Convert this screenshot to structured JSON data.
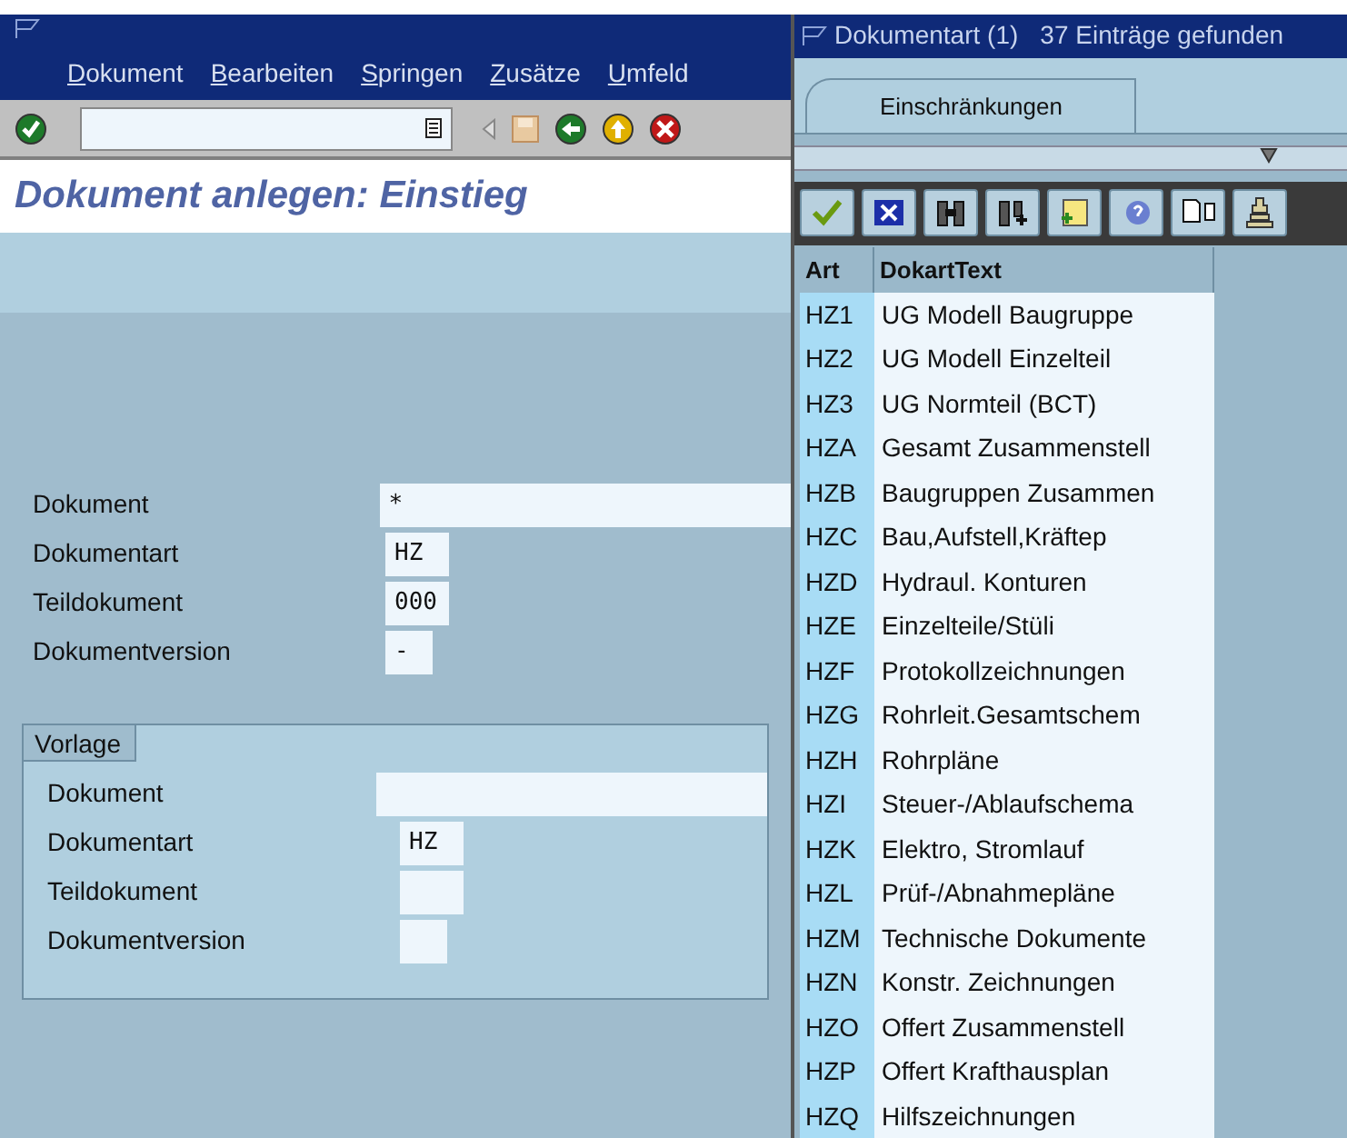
{
  "main": {
    "menu": [
      "Dokument",
      "Bearbeiten",
      "Springen",
      "Zusätze",
      "Umfeld"
    ],
    "title": "Dokument anlegen: Einstieg",
    "fields": [
      {
        "label": "Dokument",
        "value": "*"
      },
      {
        "label": "Dokumentart",
        "value": "HZ"
      },
      {
        "label": "Teildokument",
        "value": "000"
      },
      {
        "label": "Dokumentversion",
        "value": "-"
      }
    ],
    "group": {
      "title": "Vorlage",
      "fields": [
        {
          "label": "Dokument"
        },
        {
          "label": "Dokumentart",
          "value": "HZ"
        },
        {
          "label": "Teildokument"
        },
        {
          "label": "Dokumentversion"
        }
      ]
    }
  },
  "popup": {
    "title": "Dokumentart (1)",
    "count": "37 Einträge gefunden",
    "tabs": [
      {
        "label": "Einschränkungen",
        "selected": true
      }
    ],
    "columns": [
      "Art",
      "DokartText"
    ],
    "rows": [
      {
        "art": "HZ1",
        "text": "UG Modell Baugruppe"
      },
      {
        "art": "HZ2",
        "text": "UG Modell Einzelteil"
      },
      {
        "art": "HZ3",
        "text": "UG Normteil (BCT)"
      },
      {
        "art": "HZA",
        "text": "Gesamt Zusammenstell"
      },
      {
        "art": "HZB",
        "text": "Baugruppen Zusammen"
      },
      {
        "art": "HZC",
        "text": "Bau,Aufstell,Kräftep"
      },
      {
        "art": "HZD",
        "text": "Hydraul. Konturen"
      },
      {
        "art": "HZE",
        "text": "Einzelteile/Stüli"
      },
      {
        "art": "HZF",
        "text": "Protokollzeichnungen"
      },
      {
        "art": "HZG",
        "text": "Rohrleit.Gesamtschem"
      },
      {
        "art": "HZH",
        "text": "Rohrpläne"
      },
      {
        "art": "HZI",
        "text": "Steuer-/Ablaufschema"
      },
      {
        "art": "HZK",
        "text": "Elektro, Stromlauf"
      },
      {
        "art": "HZL",
        "text": "Prüf-/Abnahmepläne"
      },
      {
        "art": "HZM",
        "text": "Technische Dokumente"
      },
      {
        "art": "HZN",
        "text": "Konstr. Zeichnungen"
      },
      {
        "art": "HZO",
        "text": "Offert Zusammenstell"
      },
      {
        "art": "HZP",
        "text": "Offert Krafthausplan"
      },
      {
        "art": "HZQ",
        "text": "Hilfszeichnungen"
      }
    ]
  }
}
